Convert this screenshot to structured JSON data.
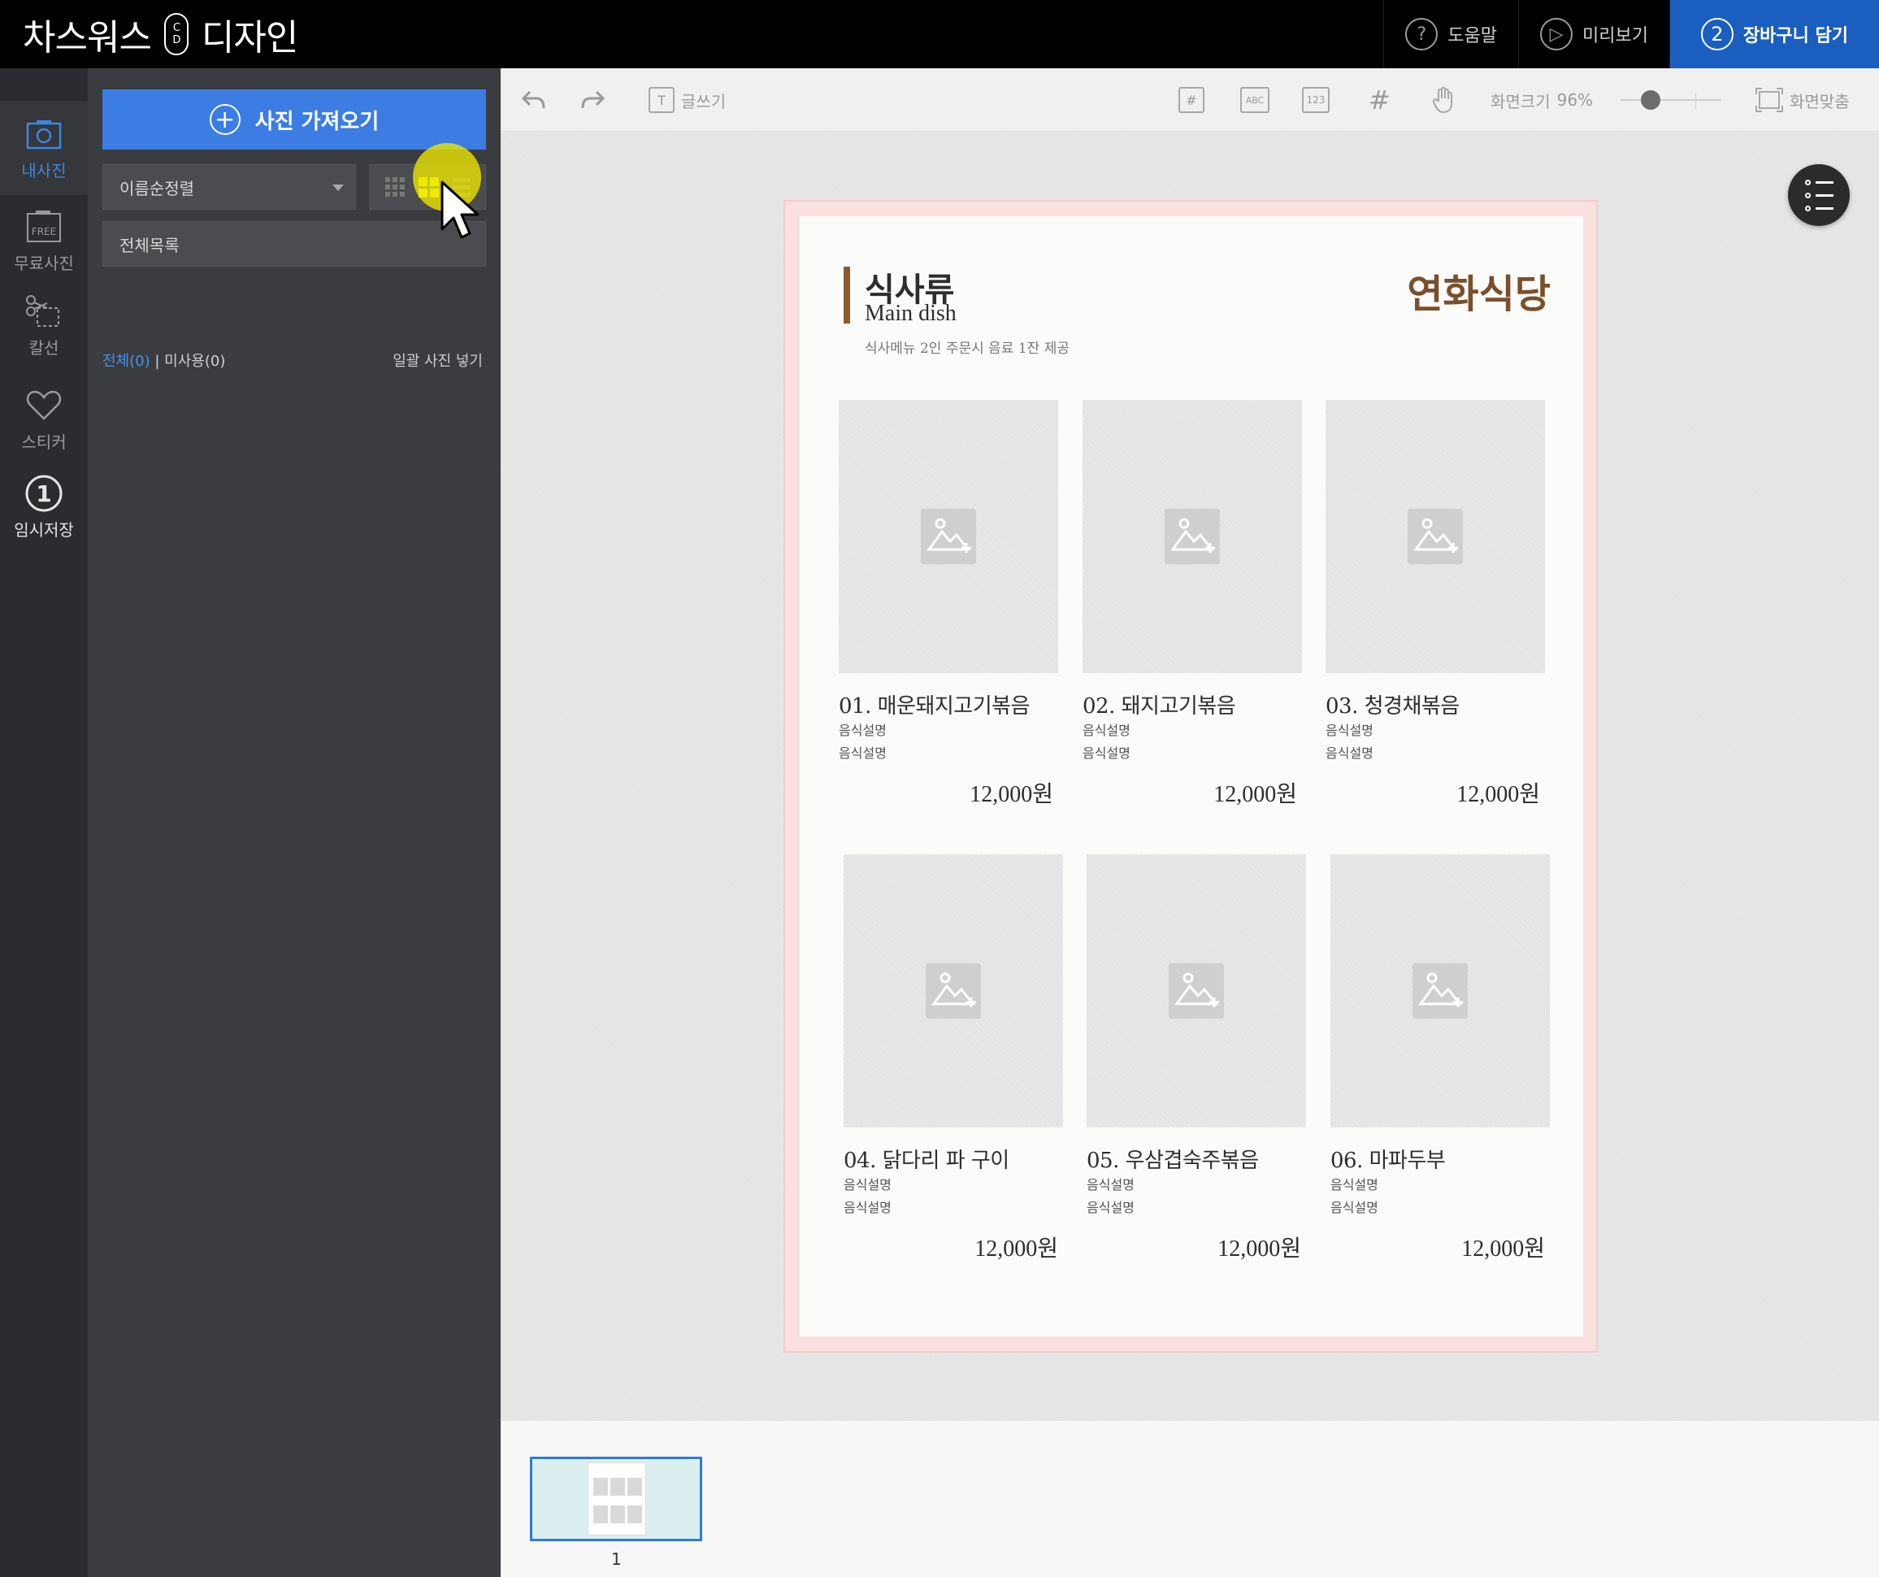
{
  "app": {
    "brand_left": "차스워스",
    "brand_pill_top": "C",
    "brand_pill_bottom": "D",
    "brand_right": "디자인"
  },
  "top_actions": {
    "help": {
      "icon": "?",
      "label": "도움말"
    },
    "preview": {
      "icon": "▷",
      "label": "미리보기"
    },
    "cart": {
      "icon": "2",
      "label": "장바구니 담기"
    }
  },
  "rail": [
    {
      "label": "내사진",
      "icon": "camera-icon",
      "active": true
    },
    {
      "label": "무료사진",
      "icon": "free-photo-icon",
      "badge": "FREE"
    },
    {
      "label": "칼선",
      "icon": "scissors-icon"
    },
    {
      "label": "스티커",
      "icon": "heart-icon"
    },
    {
      "label": "임시저장",
      "icon": "number-one-icon",
      "badge": "1"
    }
  ],
  "panel": {
    "import_label": "사진 가져오기",
    "sort_value": "이름순정렬",
    "folder_value": "전체목록",
    "count_all": "전체(0)",
    "count_sep": "|",
    "count_unused": "미사용(0)",
    "bulk_insert": "일괄 사진 넣기"
  },
  "toolbar": {
    "text_tool": "글쓰기",
    "text_tool_icon": "T",
    "abc_icon": "ABC",
    "num_icon": "123",
    "zoom_label": "화면크기",
    "zoom_value": "96%",
    "zoom_fraction": 0.3,
    "fit_label": "화면맞춤"
  },
  "menu": {
    "category_title": "식사류",
    "category_subtitle": "Main dish",
    "restaurant_name": "연화식당",
    "note": "식사메뉴 2인 주문시 음료 1잔 제공",
    "items": [
      {
        "name": "01. 매운돼지고기볶음",
        "desc1": "음식설명",
        "desc2": "음식설명",
        "price": "12,000원"
      },
      {
        "name": "02. 돼지고기볶음",
        "desc1": "음식설명",
        "desc2": "음식설명",
        "price": "12,000원"
      },
      {
        "name": "03. 청경채볶음",
        "desc1": "음식설명",
        "desc2": "음식설명",
        "price": "12,000원"
      },
      {
        "name": "04. 닭다리 파 구이",
        "desc1": "음식설명",
        "desc2": "음식설명",
        "price": "12,000원"
      },
      {
        "name": "05. 우삼겹숙주볶음",
        "desc1": "음식설명",
        "desc2": "음식설명",
        "price": "12,000원"
      },
      {
        "name": "06. 마파두부",
        "desc1": "음식설명",
        "desc2": "음식설명",
        "price": "12,000원"
      }
    ]
  },
  "pages": {
    "current": "1"
  },
  "colors": {
    "accent_blue": "#3b7de3",
    "cart_blue": "#1a5fc0",
    "brand_brown": "#7a4f2c",
    "highlight_yellow": "#eee800"
  }
}
